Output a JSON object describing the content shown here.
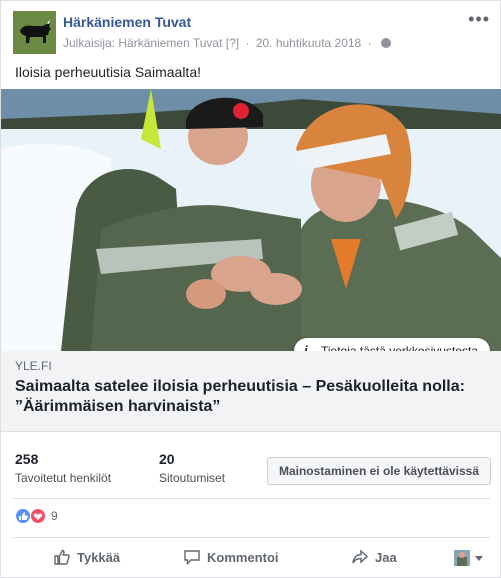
{
  "post": {
    "page_name": "Härkäniemen Tuvat",
    "publisher_prefix": "Julkaisija:",
    "publisher": "Härkäniemen Tuvat",
    "publisher_help": "[?]",
    "date": "20. huhtikuuta 2018",
    "text": "Iloisia perheuutisia Saimaalta!"
  },
  "link_preview": {
    "about_label": "Tietoja tästä verkkosivustosta",
    "domain": "YLE.FI",
    "headline": "Saimaalta satelee iloisia perheuutisia – Pesäkuolleita nolla: ”Äärimmäisen harvinaista”"
  },
  "insights": {
    "reach_value": "258",
    "reach_label": "Tavoitetut henkilöt",
    "engagement_value": "20",
    "engagement_label": "Sitoutumiset",
    "promote_label": "Mainostaminen ei ole käytettävissä"
  },
  "reactions": {
    "count": "9",
    "types": [
      "like-icon",
      "love-icon"
    ]
  },
  "actions": {
    "like": "Tykkää",
    "comment": "Kommentoi",
    "share": "Jaa"
  },
  "colors": {
    "link_blue": "#365899",
    "like_blue": "#5890ff",
    "love_red": "#f25268"
  }
}
